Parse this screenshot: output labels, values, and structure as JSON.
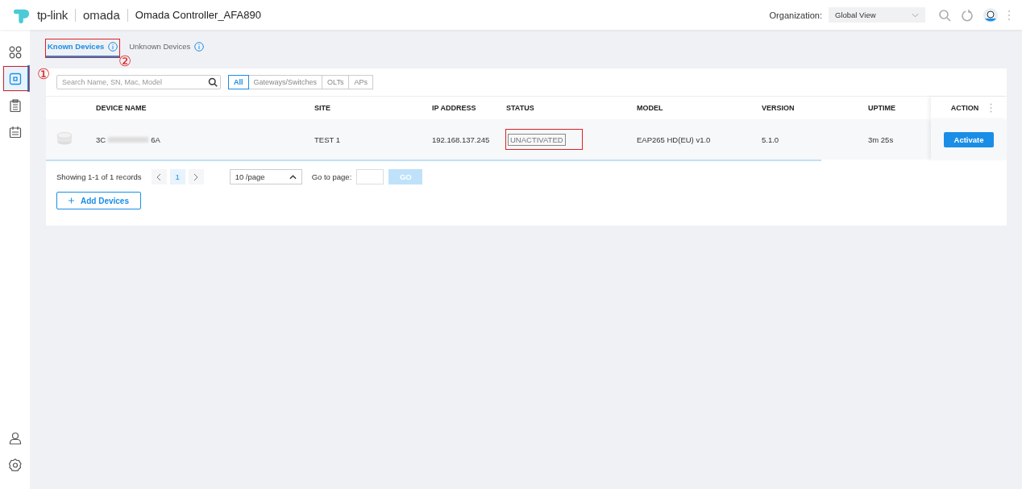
{
  "header": {
    "logo_brand": "tp-link",
    "logo_product": "omada",
    "title": "Omada Controller_AFA890",
    "org_label": "Organization:",
    "org_value": "Global View"
  },
  "sidebar": {
    "items": [
      {
        "kind": "grid",
        "selected": false,
        "highlighted": false
      },
      {
        "kind": "device",
        "selected": true,
        "highlighted": true
      },
      {
        "kind": "clipboard",
        "selected": false,
        "highlighted": false
      },
      {
        "kind": "calendar",
        "selected": false,
        "highlighted": false
      }
    ],
    "bottom_items": [
      {
        "kind": "user"
      },
      {
        "kind": "gear"
      }
    ]
  },
  "tabs": [
    {
      "label": "Known Devices",
      "selected": true,
      "highlighted": true
    },
    {
      "label": "Unknown Devices",
      "selected": false,
      "highlighted": false
    }
  ],
  "markers": [
    "①",
    "②"
  ],
  "search": {
    "placeholder": "Search Name, SN, Mac, Model"
  },
  "filters": [
    {
      "label": "All",
      "selected": true
    },
    {
      "label": "Gateways/Switches",
      "selected": false
    },
    {
      "label": "OLTs",
      "selected": false
    },
    {
      "label": "APs",
      "selected": false
    }
  ],
  "table": {
    "columns": [
      "DEVICE NAME",
      "SITE",
      "IP ADDRESS",
      "STATUS",
      "MODEL",
      "VERSION",
      "UPTIME",
      "ACTION"
    ],
    "rows": [
      {
        "name_start": "3C",
        "name_end": "6A",
        "site": "TEST 1",
        "ip": "192.168.137.245",
        "status": "UNACTIVATED",
        "status_highlighted": true,
        "model": "EAP265 HD(EU) v1.0",
        "version": "5.1.0",
        "uptime": "3m 25s",
        "action": "Activate"
      }
    ]
  },
  "pagination": {
    "summary": "Showing 1-1 of 1 records",
    "pages": [
      {
        "label": "1",
        "selected": true
      }
    ],
    "page_size": "10 /page",
    "goto_label": "Go to page:",
    "go": "GO"
  },
  "add_button": "Add Devices"
}
